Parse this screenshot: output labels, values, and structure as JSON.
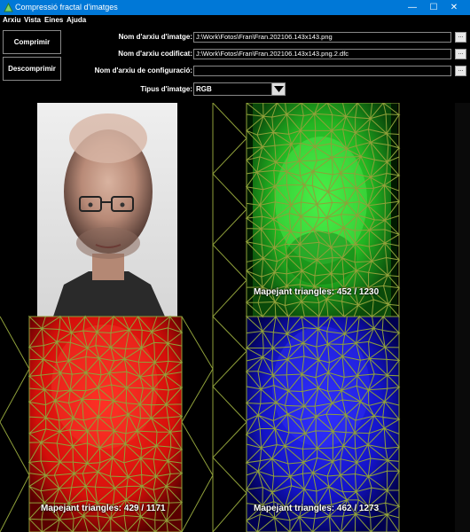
{
  "window": {
    "title": "Compressió fractal d'imatges",
    "minimize": "—",
    "maximize": "☐",
    "close": "✕"
  },
  "menu": [
    {
      "label": "Arxiu"
    },
    {
      "label": "Vista"
    },
    {
      "label": "Eines"
    },
    {
      "label": "Ajuda"
    }
  ],
  "actions": {
    "compress": "Comprimir",
    "decompress": "Descomprimir"
  },
  "fields": {
    "image_file": {
      "label": "Nom d'arxiu d'imatge:",
      "value": "J:\\Work\\Fotos\\Fran\\Fran.202106.143x143.png",
      "browse": "..."
    },
    "encoded_file": {
      "label": "Nom d'arxiu codificat:",
      "value": "J:\\Work\\Fotos\\Fran\\Fran.202106.143x143.png.2.dfc",
      "browse": "..."
    },
    "config_file": {
      "label": "Nom d'arxiu de configuració:",
      "value": "",
      "browse": "..."
    },
    "image_type": {
      "label": "Tipus d'imatge:",
      "value": "RGB"
    }
  },
  "panes": {
    "original": {
      "label": ""
    },
    "green": {
      "label": "Mapejant triangles: 452 / 1230",
      "color": "#2ee02e"
    },
    "red": {
      "label": "Mapejant triangles: 429 / 1171",
      "color": "#e01a14"
    },
    "blue": {
      "label": "Mapejant triangles: 462 / 1273",
      "color": "#1a22d8"
    }
  },
  "colors": {
    "mesh": "#8fa03a",
    "titlebar": "#0078d7"
  }
}
